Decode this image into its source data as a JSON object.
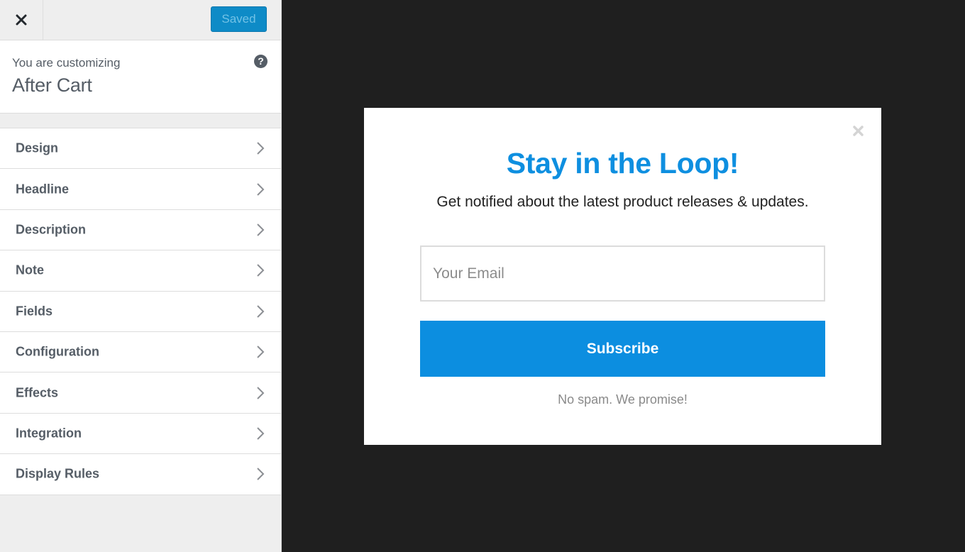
{
  "sidebar": {
    "header": {
      "close_icon": "close-icon",
      "saved_label": "Saved"
    },
    "info": {
      "label": "You are customizing",
      "title": "After Cart",
      "help_icon": "?"
    },
    "items": [
      {
        "label": "Design"
      },
      {
        "label": "Headline"
      },
      {
        "label": "Description"
      },
      {
        "label": "Note"
      },
      {
        "label": "Fields"
      },
      {
        "label": "Configuration"
      },
      {
        "label": "Effects"
      },
      {
        "label": "Integration"
      },
      {
        "label": "Display Rules"
      }
    ]
  },
  "popup": {
    "title": "Stay in the Loop!",
    "description": "Get notified about the latest product releases & updates.",
    "email_placeholder": "Your Email",
    "email_value": "",
    "subscribe_label": "Subscribe",
    "note": "No spam. We promise!"
  },
  "colors": {
    "accent": "#0e8fe0",
    "saved_button": "#0e8bc7",
    "preview_background": "#1f1f1f",
    "sidebar_text": "#555d66"
  }
}
